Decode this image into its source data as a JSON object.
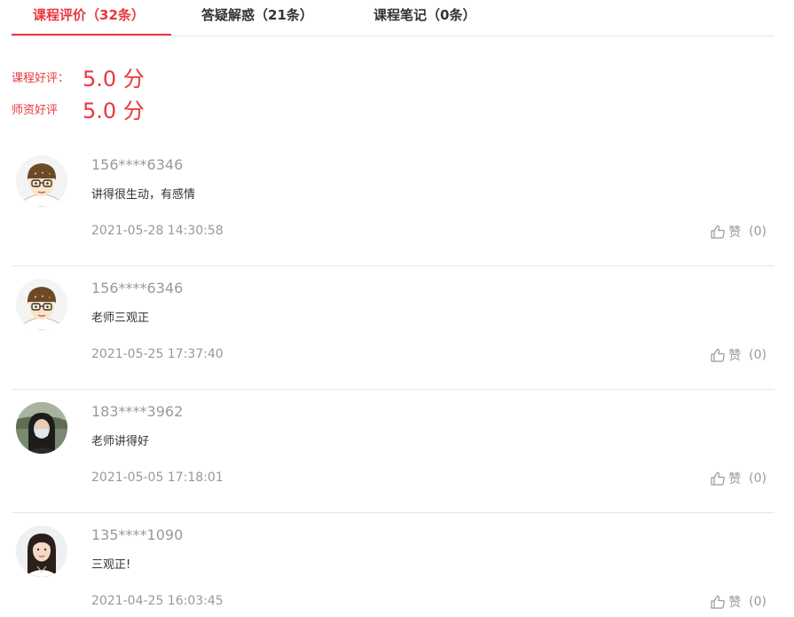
{
  "tabs": [
    {
      "label": "课程评价（32条）",
      "active": true
    },
    {
      "label": "答疑解惑（21条）",
      "active": false
    },
    {
      "label": "课程笔记（0条）",
      "active": false
    }
  ],
  "ratings": [
    {
      "label": "课程好评：",
      "value": "5.0 分"
    },
    {
      "label": "师资好评",
      "value": "5.0 分"
    }
  ],
  "colors": {
    "accent": "#e8383d",
    "muted_text": "#999999",
    "body_text": "#333333",
    "divider": "#e6e6e6"
  },
  "comments": [
    {
      "avatar": "cartoon-boy-avatar",
      "username": "156****6346",
      "content": "讲得很生动，有感情",
      "time": "2021-05-28 14:30:58",
      "like_label": "赞",
      "like_count": "(0)"
    },
    {
      "avatar": "cartoon-boy-avatar",
      "username": "156****6346",
      "content": "老师三观正",
      "time": "2021-05-25 17:37:40",
      "like_label": "赞",
      "like_count": "(0)"
    },
    {
      "avatar": "photo-masked-woman-avatar",
      "username": "183****3962",
      "content": "老师讲得好",
      "time": "2021-05-05 17:18:01",
      "like_label": "赞",
      "like_count": "(0)"
    },
    {
      "avatar": "photo-woman-portrait-avatar",
      "username": "135****1090",
      "content": "三观正!",
      "time": "2021-04-25 16:03:45",
      "like_label": "赞",
      "like_count": "(0)"
    }
  ]
}
